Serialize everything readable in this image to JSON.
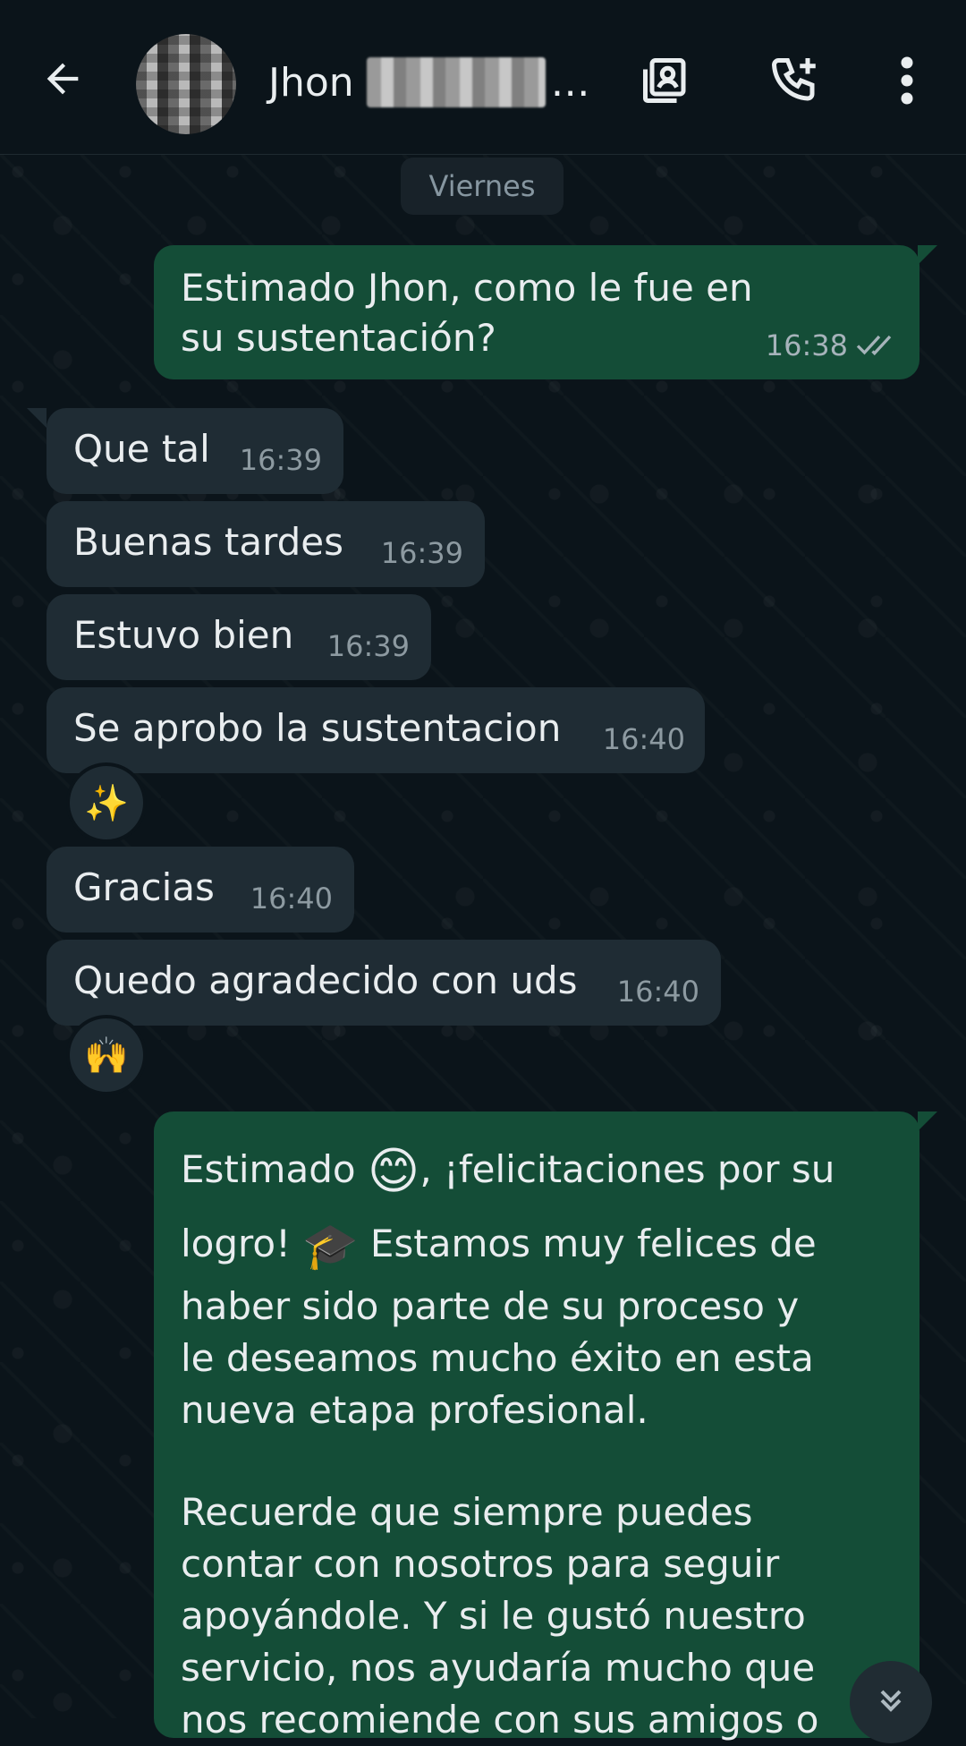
{
  "header": {
    "contact_name": "Jhon",
    "ellipsis": "…"
  },
  "date_chip": "Viernes",
  "messages": {
    "m1": {
      "text": "Estimado Jhon, como le fue en su sustentación?",
      "time": "16:38"
    },
    "m2": {
      "text": "Que tal",
      "time": "16:39"
    },
    "m3": {
      "text": "Buenas tardes",
      "time": "16:39"
    },
    "m4": {
      "text": "Estuvo bien",
      "time": "16:39"
    },
    "m5": {
      "text": "Se aprobo la sustentacion",
      "time": "16:40",
      "reaction": "✨"
    },
    "m6": {
      "text": "Gracias",
      "time": "16:40"
    },
    "m7": {
      "text": "Quedo agradecido con uds",
      "time": "16:40",
      "reaction": "🙌"
    },
    "m8": {
      "line1_a": "Estimado ",
      "emoji1": "😊",
      "line1_b": ", ¡felicitaciones por su",
      "line2_a": "logro! ",
      "emoji2": "🎓",
      "line2_b": " Estamos muy felices de",
      "para1_rest": "haber sido parte de su proceso y\nle deseamos mucho éxito en esta\nnueva etapa profesional.",
      "para2": "Recuerde que siempre puedes\ncontar con nosotros para seguir\napoyándole. Y si le gustó nuestro\nservicio, nos ayudaría mucho que\nnos recomiende con sus amigos o"
    }
  }
}
